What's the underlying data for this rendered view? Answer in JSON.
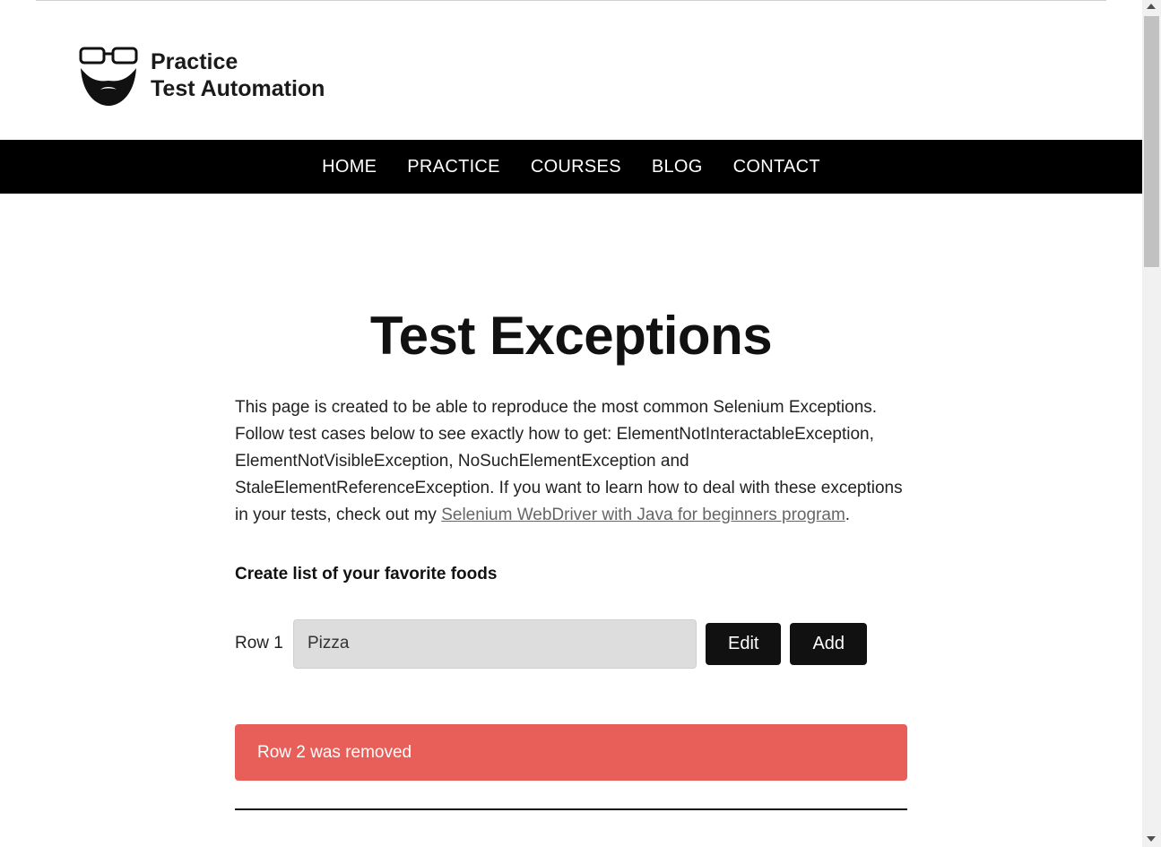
{
  "logo": {
    "line1": "Practice",
    "line2": "Test Automation"
  },
  "nav": {
    "home": "HOME",
    "practice": "PRACTICE",
    "courses": "COURSES",
    "blog": "BLOG",
    "contact": "CONTACT"
  },
  "page": {
    "title": "Test Exceptions",
    "intro_text": "This page is created to be able to reproduce the most common Selenium Exceptions. Follow test cases below to see exactly how to get: ElementNotInteractableException, ElementNotVisibleException, NoSuchElementException and StaleElementReferenceException. If you want to learn how to deal with these exceptions in your tests, check out my ",
    "intro_link": "Selenium WebDriver with Java for beginners program",
    "intro_end": ".",
    "section_heading": "Create list of your favorite foods"
  },
  "row1": {
    "label": "Row 1",
    "value": "Pizza",
    "edit_label": "Edit",
    "add_label": "Add"
  },
  "alert": {
    "message": "Row 2 was removed"
  },
  "colors": {
    "nav_bg": "#000000",
    "alert_bg": "#e85f5a",
    "button_bg": "#111111",
    "input_bg": "#dddddd"
  }
}
